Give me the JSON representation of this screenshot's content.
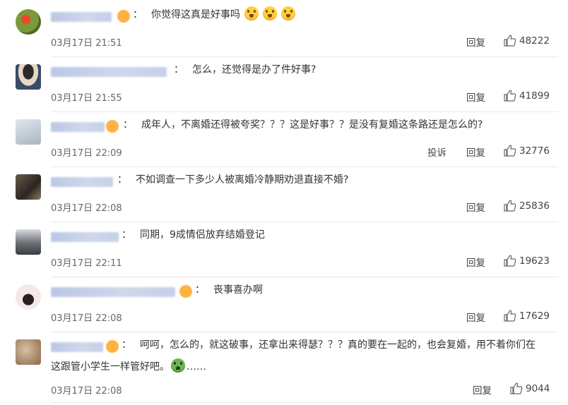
{
  "comments": [
    {
      "text": "你觉得这真是好事吗",
      "colon": "：",
      "emojis": [
        "scream-face-emoji",
        "scream-face-emoji",
        "scream-face-emoji"
      ],
      "time": "03月17日 21:51",
      "reply_label": "回复",
      "likes": "48222",
      "avatar_color": "#7a9a3a"
    },
    {
      "text": "怎么，还觉得是办了件好事?",
      "colon": "：",
      "time": "03月17日 21:55",
      "reply_label": "回复",
      "likes": "41899",
      "avatar_color": "#3a3a3a"
    },
    {
      "text": "成年人，不离婚还得被夸奖？？？这是好事？？是没有复婚这条路还是怎么的?",
      "colon": "：",
      "time": "03月17日 22:09",
      "report_label": "投诉",
      "reply_label": "回复",
      "likes": "32776",
      "avatar_color": "#c9d3dd"
    },
    {
      "text": "不如调查一下多少人被离婚冷静期劝退直接不婚?",
      "colon": "：",
      "time": "03月17日 22:08",
      "reply_label": "回复",
      "likes": "25836",
      "avatar_color": "#5a4a3a"
    },
    {
      "text": "同期，9成情侣放弃结婚登记",
      "colon": "：",
      "time": "03月17日 22:11",
      "reply_label": "回复",
      "likes": "19623",
      "avatar_color": "#8a8a8a"
    },
    {
      "text": "丧事喜办啊",
      "colon": "：",
      "time": "03月17日 22:08",
      "reply_label": "回复",
      "likes": "17629",
      "avatar_color": "#f2e6e6"
    },
    {
      "text_line1": "呵呵，怎么的，就这破事，还拿出来得瑟？？？真的要在一起的，也会复婚，用不着你们在",
      "text_line2": "这跟管小学生一样管好吧。",
      "text_tail": "……",
      "colon": "：",
      "emoji": "angry-face-emoji",
      "time": "03月17日 22:08",
      "reply_label": "回复",
      "likes": "9044",
      "avatar_color": "#b89a7a"
    }
  ],
  "colors": {
    "text": "#333333",
    "meta": "#666666",
    "username_blur": "#b7c6e4",
    "badge": "#ffb23f",
    "divider": "#e8e8e8"
  }
}
